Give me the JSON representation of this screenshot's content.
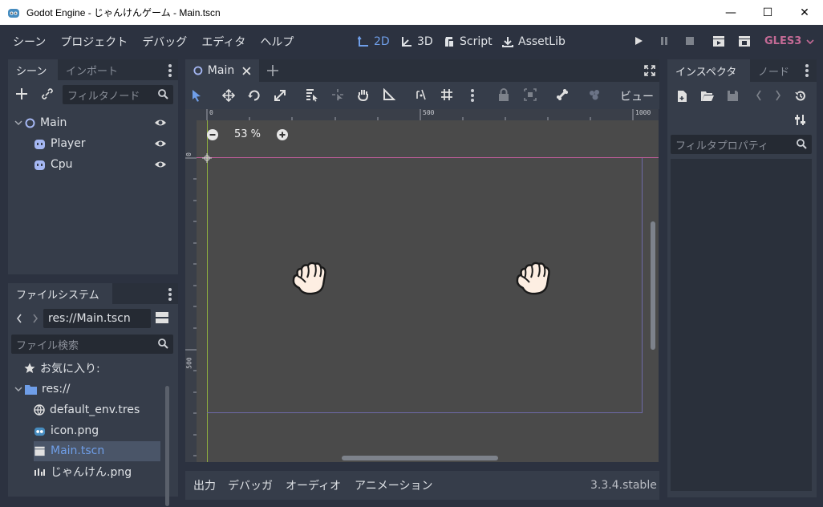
{
  "window": {
    "title": "Godot Engine - じゃんけんゲーム - Main.tscn",
    "minimize": "—",
    "maximize": "☐",
    "close": "✕"
  },
  "menu": {
    "items": [
      "シーン",
      "プロジェクト",
      "デバッグ",
      "エディタ",
      "ヘルプ"
    ]
  },
  "workspaces": {
    "w2d": "2D",
    "w3d": "3D",
    "script": "Script",
    "assetlib": "AssetLib"
  },
  "renderer": "GLES3",
  "scene_dock": {
    "tab_scene": "シーン",
    "tab_import": "インポート",
    "filter_placeholder": "フィルタノード",
    "nodes": [
      {
        "label": "Main"
      },
      {
        "label": "Player"
      },
      {
        "label": "Cpu"
      }
    ]
  },
  "filesystem_dock": {
    "tab": "ファイルシステム",
    "path": "res://Main.tscn",
    "search_placeholder": "ファイル検索",
    "items": [
      {
        "label": "お気に入り:"
      },
      {
        "label": "res://"
      },
      {
        "label": "default_env.tres"
      },
      {
        "label": "icon.png"
      },
      {
        "label": "Main.tscn"
      },
      {
        "label": "じゃんけん.png"
      }
    ]
  },
  "editor": {
    "scene_tab": "Main",
    "view_menu": "ビュー",
    "zoom": "53 %",
    "ruler_labels": {
      "x0": "0",
      "x500": "500",
      "x1000": "1000",
      "y0": "0",
      "y500": "500"
    }
  },
  "bottom_panel": {
    "tabs": [
      "出力",
      "デバッガ",
      "オーディオ",
      "アニメーション"
    ],
    "version": "3.3.4.stable"
  },
  "inspector": {
    "tab_inspector": "インスペクタ",
    "tab_node": "ノード",
    "filter_placeholder": "フィルタプロパティ"
  },
  "colors": {
    "accent": "#6f9ee8",
    "renderer": "#c36a95",
    "selection": "#4a5568"
  }
}
